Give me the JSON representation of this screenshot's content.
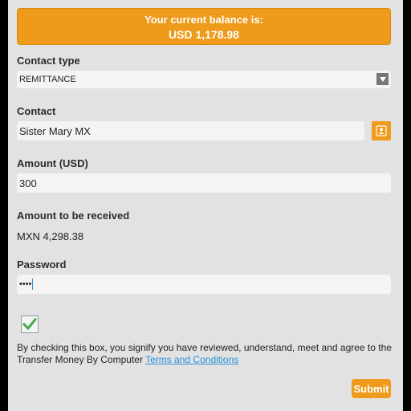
{
  "balance": {
    "title": "Your current balance is:",
    "amount": "USD 1,178.98"
  },
  "contact_type": {
    "label": "Contact type",
    "value": "REMITTANCE"
  },
  "contact": {
    "label": "Contact",
    "value": "Sister Mary MX",
    "icon": "contact-card-icon"
  },
  "amount": {
    "label": "Amount (USD)",
    "value": "300"
  },
  "received": {
    "label": "Amount to be received",
    "value": "MXN 4,298.38"
  },
  "password": {
    "label": "Password",
    "value": "••••"
  },
  "agreement": {
    "checked": true,
    "text": "By checking this box, you signify you have reviewed, understand, meet and agree to the Transfer Money By Computer",
    "link": "Terms and Conditions"
  },
  "submit_label": "Submit",
  "colors": {
    "accent": "#ee9a1a",
    "background": "#e2e2e2",
    "link": "#2a8fd8"
  }
}
